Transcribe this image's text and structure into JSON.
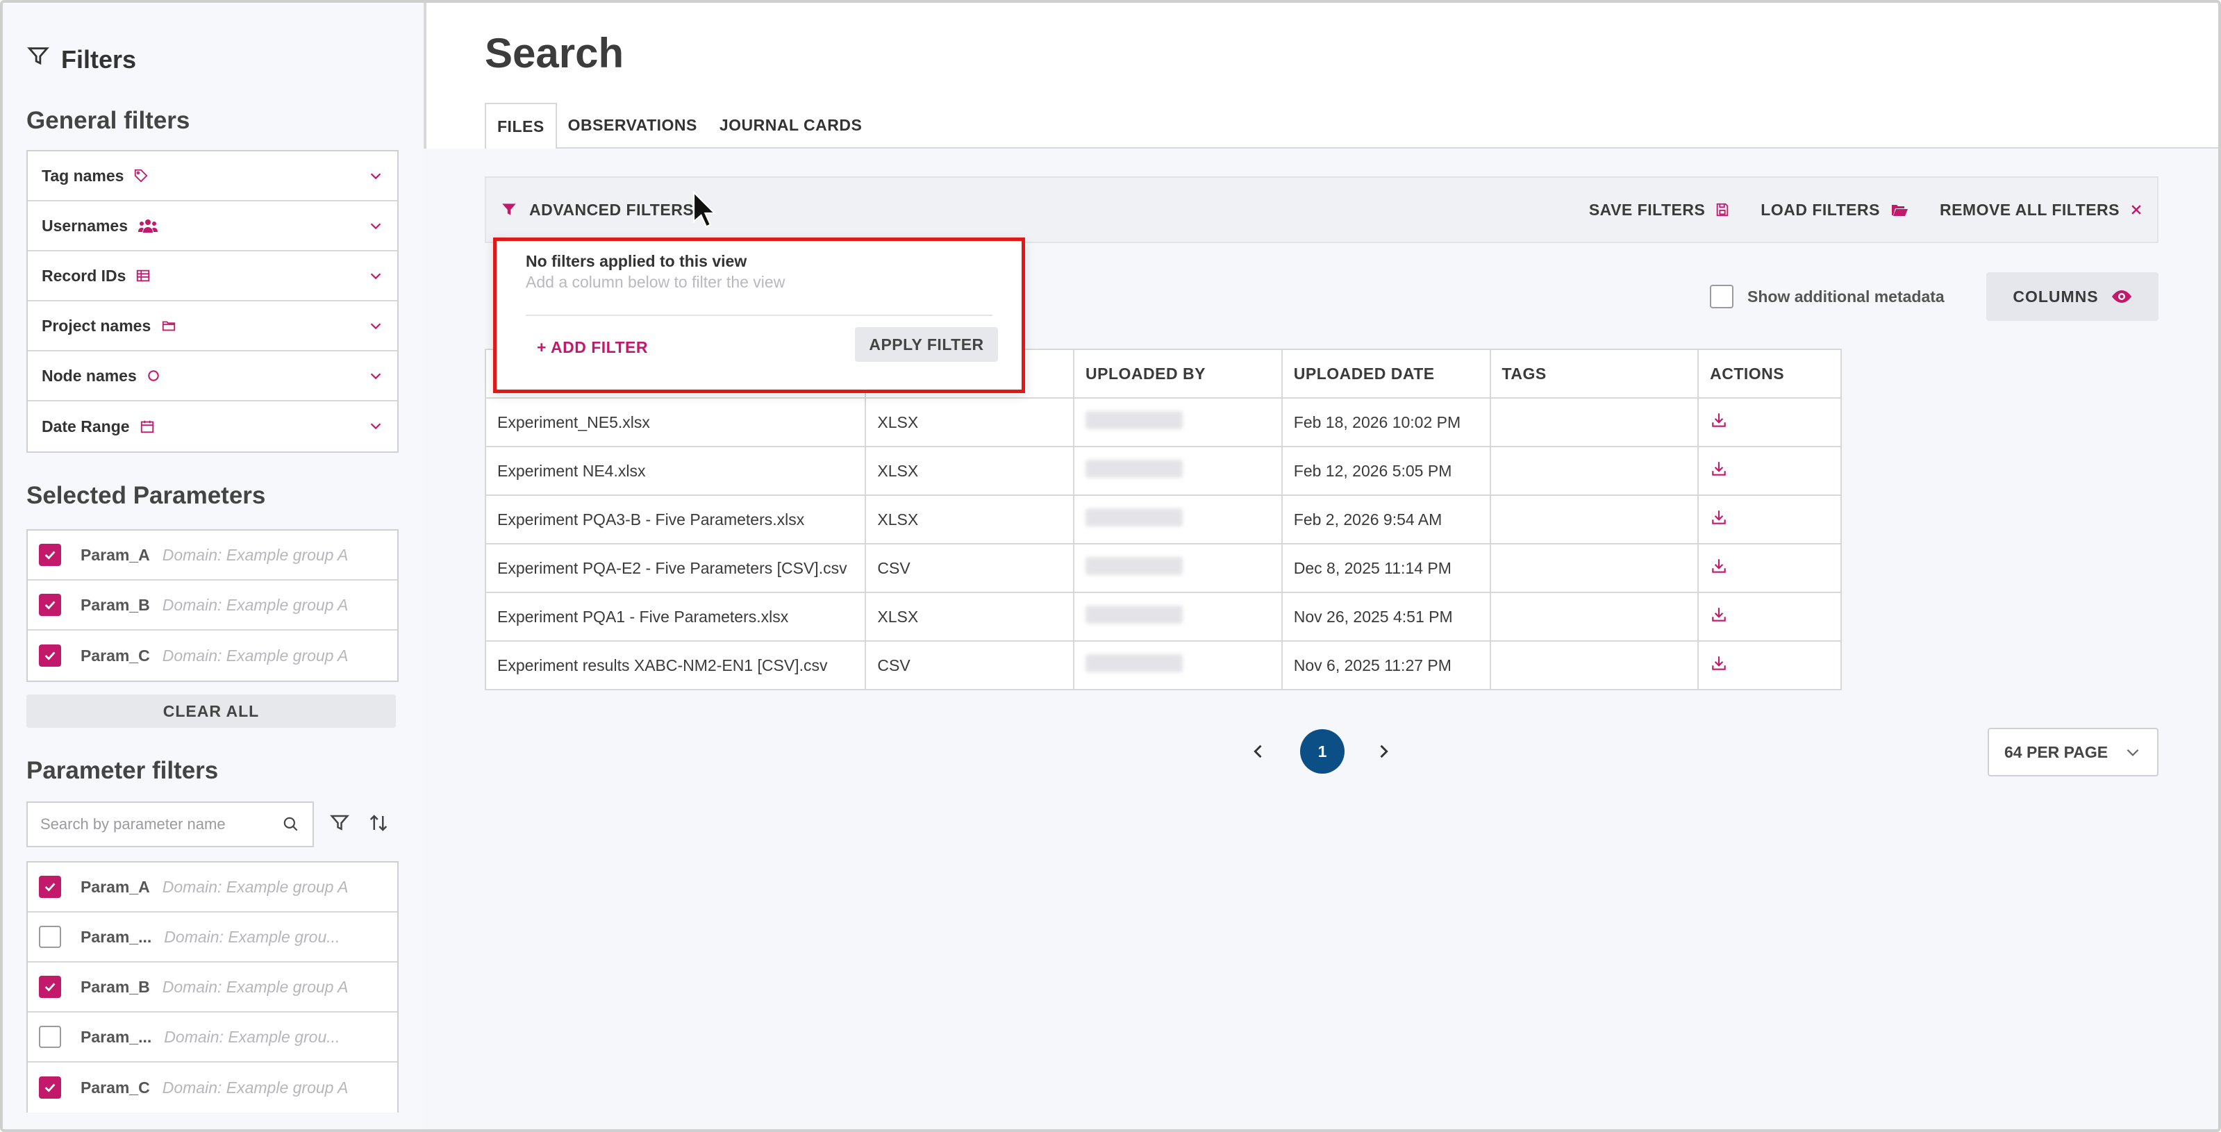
{
  "sidebar": {
    "title": "Filters",
    "general_filters": {
      "heading": "General filters",
      "items": [
        {
          "label": "Tag names",
          "icon": "tag-icon"
        },
        {
          "label": "Usernames",
          "icon": "users-icon"
        },
        {
          "label": "Record IDs",
          "icon": "table-icon"
        },
        {
          "label": "Project names",
          "icon": "folder-icon"
        },
        {
          "label": "Node names",
          "icon": "circle-icon"
        },
        {
          "label": "Date Range",
          "icon": "calendar-icon"
        }
      ]
    },
    "selected_parameters": {
      "heading": "Selected Parameters",
      "items": [
        {
          "name": "Param_A",
          "domain": "Domain: Example group A",
          "checked": true
        },
        {
          "name": "Param_B",
          "domain": "Domain: Example group A",
          "checked": true
        },
        {
          "name": "Param_C",
          "domain": "Domain: Example group A",
          "checked": true
        }
      ],
      "clear_label": "CLEAR ALL"
    },
    "parameter_filters": {
      "heading": "Parameter filters",
      "search_placeholder": "Search by parameter name",
      "items": [
        {
          "name": "Param_A",
          "domain": "Domain: Example group A",
          "checked": true
        },
        {
          "name": "Param_...",
          "domain": "Domain: Example grou...",
          "checked": false
        },
        {
          "name": "Param_B",
          "domain": "Domain: Example group A",
          "checked": true
        },
        {
          "name": "Param_...",
          "domain": "Domain: Example grou...",
          "checked": false
        },
        {
          "name": "Param_C",
          "domain": "Domain: Example group A",
          "checked": true
        }
      ]
    }
  },
  "main": {
    "title": "Search",
    "tabs": [
      {
        "label": "FILES",
        "active": true
      },
      {
        "label": "OBSERVATIONS",
        "active": false
      },
      {
        "label": "JOURNAL CARDS",
        "active": false
      }
    ],
    "advanced": {
      "label": "ADVANCED FILTERS",
      "save": "SAVE FILTERS",
      "load": "LOAD FILTERS",
      "remove": "REMOVE ALL FILTERS"
    },
    "popover": {
      "title": "No filters applied to this view",
      "subtitle": "Add a column below to filter the view",
      "add": "+ ADD FILTER",
      "apply": "APPLY FILTER"
    },
    "meta_label": "Show additional metadata",
    "columns_label": "COLUMNS",
    "table": {
      "headers": [
        "",
        "",
        "UPLOADED BY",
        "UPLOADED DATE",
        "TAGS",
        "ACTIONS"
      ],
      "rows": [
        {
          "name": "Experiment_NE5.xlsx",
          "type": "XLSX",
          "date": "Feb 18, 2026 10:02 PM"
        },
        {
          "name": "Experiment NE4.xlsx",
          "type": "XLSX",
          "date": "Feb 12, 2026 5:05 PM"
        },
        {
          "name": "Experiment PQA3-B - Five Parameters.xlsx",
          "type": "XLSX",
          "date": "Feb 2, 2026 9:54 AM"
        },
        {
          "name": "Experiment PQA-E2 - Five Parameters [CSV].csv",
          "type": "CSV",
          "date": "Dec 8, 2025 11:14 PM"
        },
        {
          "name": "Experiment PQA1 - Five Parameters.xlsx",
          "type": "XLSX",
          "date": "Nov 26, 2025 4:51 PM"
        },
        {
          "name": "Experiment results XABC-NM2-EN1 [CSV].csv",
          "type": "CSV",
          "date": "Nov 6, 2025 11:27 PM"
        }
      ]
    },
    "pagination": {
      "current": "1",
      "per_page": "64 PER PAGE"
    }
  },
  "colors": {
    "accent": "#c2196b",
    "page_active": "#0b4f86",
    "highlight": "#e01818"
  }
}
